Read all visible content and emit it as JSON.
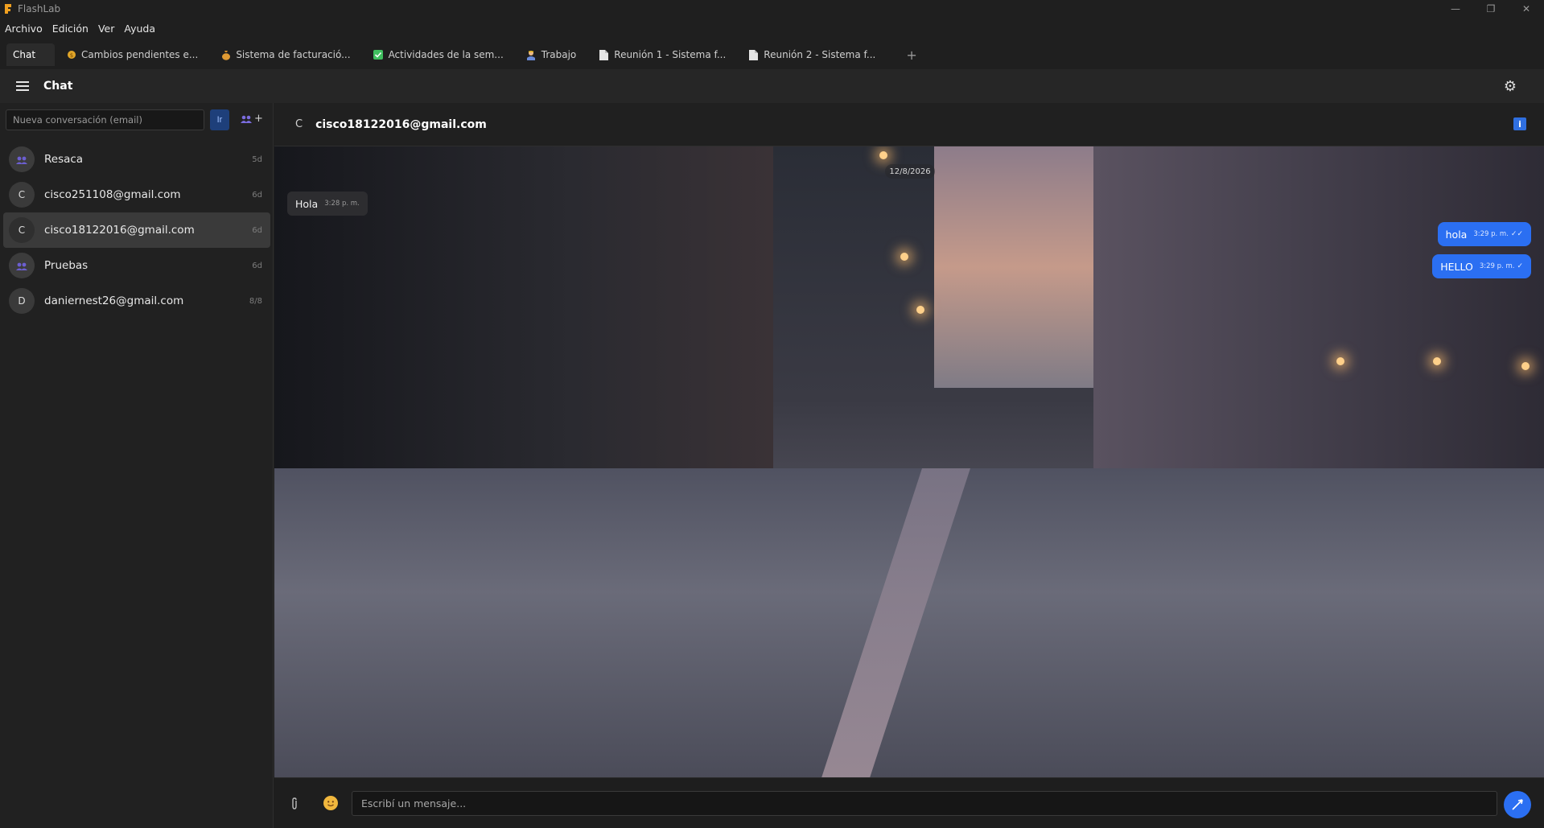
{
  "window": {
    "title": "FlashLab",
    "controls": {
      "minimize": "—",
      "maximize": "❐",
      "close": "✕"
    }
  },
  "menubar": {
    "items": [
      "Archivo",
      "Edición",
      "Ver",
      "Ayuda"
    ]
  },
  "tabs": [
    {
      "label": "Chat",
      "icon": "none",
      "active": true
    },
    {
      "label": "Cambios pendientes e...",
      "icon": "coin-icon"
    },
    {
      "label": "Sistema de facturació...",
      "icon": "money-bag-icon"
    },
    {
      "label": "Actividades de la sem...",
      "icon": "checkbox-icon"
    },
    {
      "label": "Trabajo",
      "icon": "worker-icon"
    },
    {
      "label": "Reunión 1 - Sistema f...",
      "icon": "document-icon"
    },
    {
      "label": "Reunión 2 - Sistema f...",
      "icon": "document-icon"
    }
  ],
  "tab_add": "+",
  "header": {
    "title": "Chat"
  },
  "sidebar": {
    "new_conversation_placeholder": "Nueva conversación (email)",
    "go_label": "Ir",
    "group_add_plus": "+",
    "conversations": [
      {
        "name": "Resaca",
        "time": "5d",
        "avatar": "",
        "type": "group"
      },
      {
        "name": "cisco251108@gmail.com",
        "time": "6d",
        "avatar": "C",
        "type": "user"
      },
      {
        "name": "cisco18122016@gmail.com",
        "time": "6d",
        "avatar": "C",
        "type": "user",
        "selected": true
      },
      {
        "name": "Pruebas",
        "time": "6d",
        "avatar": "",
        "type": "group"
      },
      {
        "name": "daniernest26@gmail.com",
        "time": "8/8",
        "avatar": "D",
        "type": "user"
      }
    ]
  },
  "chat": {
    "avatar": "C",
    "title": "cisco18122016@gmail.com",
    "info_label": "i",
    "date": "12/8/2026",
    "messages": [
      {
        "direction": "in",
        "text": "Hola",
        "time": "3:28 p. m."
      },
      {
        "direction": "out",
        "text": "hola",
        "time": "3:29 p. m.",
        "status": "✓✓"
      },
      {
        "direction": "out",
        "text": "HELLO",
        "time": "3:29 p. m.",
        "status": "✓"
      }
    ]
  },
  "composer": {
    "placeholder": "Escribí un mensaje...",
    "clip_icon": "paperclip-icon",
    "emoji_icon": "emoji-icon",
    "send_icon": "send-icon"
  },
  "colors": {
    "accent": "#2b6ff2",
    "background": "#1f1f1f",
    "sidebar": "#212121",
    "selected_row": "#3a3a3a"
  }
}
